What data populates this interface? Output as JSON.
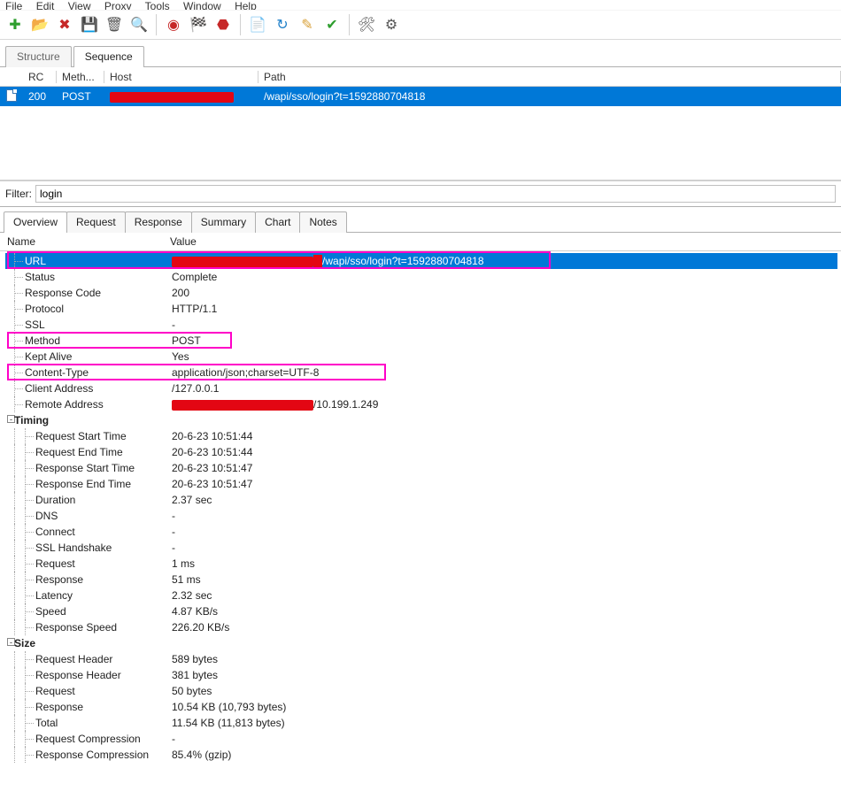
{
  "menu": [
    "File",
    "Edit",
    "View",
    "Proxy",
    "Tools",
    "Window",
    "Help"
  ],
  "toolbar_icons": [
    {
      "name": "new-icon",
      "glyph": "✚",
      "color": "#2e9e2e"
    },
    {
      "name": "open-icon",
      "glyph": "📂",
      "color": "#d8a038"
    },
    {
      "name": "close-session-icon",
      "glyph": "✖",
      "color": "#c62828"
    },
    {
      "name": "save-icon",
      "glyph": "💾",
      "color": "#444"
    },
    {
      "name": "trash-icon",
      "glyph": "🗑",
      "color": "#555"
    },
    {
      "name": "find-icon",
      "glyph": "🔍",
      "color": "#333"
    },
    {
      "sep": true
    },
    {
      "name": "record-icon",
      "glyph": "◉",
      "color": "#c62828"
    },
    {
      "name": "throttle-icon",
      "glyph": "🏁",
      "color": "#333"
    },
    {
      "name": "stop-icon",
      "glyph": "⬣",
      "color": "#c62828"
    },
    {
      "sep": true
    },
    {
      "name": "compose-icon",
      "glyph": "📄",
      "color": "#3b78b5"
    },
    {
      "name": "repeat-icon",
      "glyph": "↻",
      "color": "#1e7fc9"
    },
    {
      "name": "edit-icon",
      "glyph": "✎",
      "color": "#d8a038"
    },
    {
      "name": "validate-icon",
      "glyph": "✔",
      "color": "#2e9e2e"
    },
    {
      "sep": true
    },
    {
      "name": "tools-icon",
      "glyph": "🛠",
      "color": "#555"
    },
    {
      "name": "settings-icon",
      "glyph": "⚙",
      "color": "#555"
    }
  ],
  "top_tabs": {
    "structure": "Structure",
    "sequence": "Sequence"
  },
  "columns": {
    "rc": "RC",
    "method": "Meth...",
    "host": "Host",
    "path": "Path"
  },
  "row": {
    "rc": "200",
    "method": "POST",
    "host": "[redacted]",
    "path": "/wapi/sso/login?t=1592880704818"
  },
  "filter": {
    "label": "Filter:",
    "value": "login"
  },
  "detail_tabs": [
    "Overview",
    "Request",
    "Response",
    "Summary",
    "Chart",
    "Notes"
  ],
  "kv_header": {
    "name": "Name",
    "value": "Value"
  },
  "overview": {
    "url_label": "URL",
    "url_value_suffix": "/wapi/sso/login?t=1592880704818",
    "status": {
      "label": "Status",
      "value": "Complete"
    },
    "response_code": {
      "label": "Response Code",
      "value": "200"
    },
    "protocol": {
      "label": "Protocol",
      "value": "HTTP/1.1"
    },
    "ssl": {
      "label": "SSL",
      "value": "-"
    },
    "method": {
      "label": "Method",
      "value": "POST"
    },
    "kept_alive": {
      "label": "Kept Alive",
      "value": "Yes"
    },
    "content_type": {
      "label": "Content-Type",
      "value": "application/json;charset=UTF-8"
    },
    "client_address": {
      "label": "Client Address",
      "value": "/127.0.0.1"
    },
    "remote_address": {
      "label": "Remote Address",
      "value_suffix": "/10.199.1.249"
    },
    "timing_label": "Timing",
    "timing": {
      "req_start": {
        "label": "Request Start Time",
        "value": "20-6-23 10:51:44"
      },
      "req_end": {
        "label": "Request End Time",
        "value": "20-6-23 10:51:44"
      },
      "res_start": {
        "label": "Response Start Time",
        "value": "20-6-23 10:51:47"
      },
      "res_end": {
        "label": "Response End Time",
        "value": "20-6-23 10:51:47"
      },
      "duration": {
        "label": "Duration",
        "value": "2.37 sec"
      },
      "dns": {
        "label": "DNS",
        "value": "-"
      },
      "connect": {
        "label": "Connect",
        "value": "-"
      },
      "ssl_hs": {
        "label": "SSL Handshake",
        "value": "-"
      },
      "request": {
        "label": "Request",
        "value": "1 ms"
      },
      "response": {
        "label": "Response",
        "value": "51 ms"
      },
      "latency": {
        "label": "Latency",
        "value": "2.32 sec"
      },
      "speed": {
        "label": "Speed",
        "value": "4.87 KB/s"
      },
      "resp_speed": {
        "label": "Response Speed",
        "value": "226.20 KB/s"
      }
    },
    "size_label": "Size",
    "size": {
      "req_header": {
        "label": "Request Header",
        "value": "589 bytes"
      },
      "res_header": {
        "label": "Response Header",
        "value": "381 bytes"
      },
      "request": {
        "label": "Request",
        "value": "50 bytes"
      },
      "response": {
        "label": "Response",
        "value": "10.54 KB (10,793 bytes)"
      },
      "total": {
        "label": "Total",
        "value": "11.54 KB (11,813 bytes)"
      },
      "req_comp": {
        "label": "Request Compression",
        "value": "-"
      },
      "res_comp": {
        "label": "Response Compression",
        "value": "85.4% (gzip)"
      }
    }
  }
}
